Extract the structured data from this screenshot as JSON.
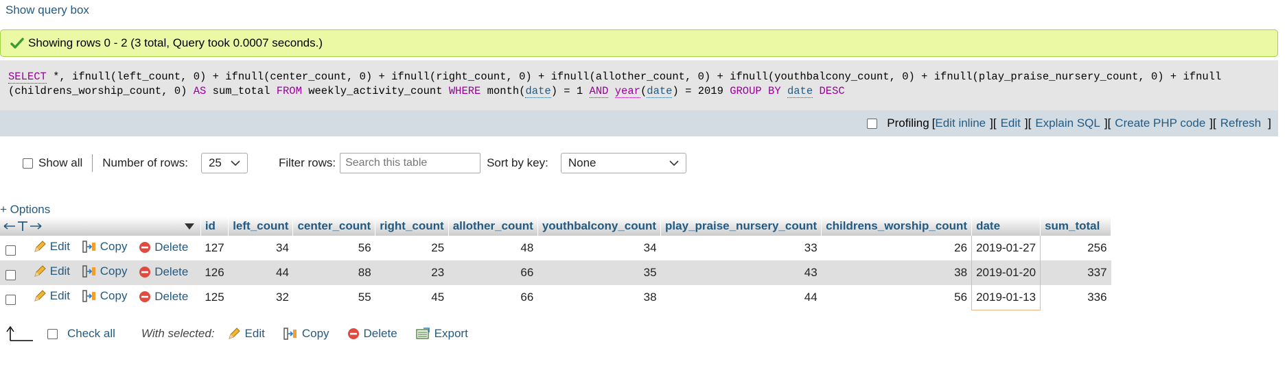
{
  "top": {
    "show_query_label": "Show query box"
  },
  "success": {
    "message": "Showing rows 0 - 2 (3 total, Query took 0.0007 seconds.)"
  },
  "sql": {
    "t1": "SELECT",
    "t2": " *, ifnull(left_count, 0) + ifnull(center_count, 0) + ifnull(right_count, 0) + ifnull(allother_count, 0) + ifnull(youthbalcony_count, 0) + ifnull(play_praise_nursery_count, 0) + ifnull (childrens_worship_count, 0) ",
    "t3": "AS",
    "t4": " sum_total ",
    "t5": "FROM",
    "t6": " weekly_activity_count ",
    "t7": "WHERE",
    "t8": " month(",
    "t9": "date",
    "t10": ") = 1 ",
    "t11": "AND",
    "t12": " ",
    "t13": "year",
    "t14": "(",
    "t15": "date",
    "t16": ") = 2019 ",
    "t17": "GROUP BY",
    "t18": " ",
    "t19": "date",
    "t20": " ",
    "t21": "DESC"
  },
  "profiling": {
    "label": "Profiling",
    "open_bracket": "[",
    "edit_inline": "Edit inline",
    "edit": "Edit",
    "explain": "Explain SQL",
    "php": "Create PHP code",
    "refresh": "Refresh",
    "sep": "][",
    "close_bracket": "]"
  },
  "nav": {
    "show_all": "Show all",
    "rows_label": "Number of rows:",
    "rows_value": "25",
    "filter_label": "Filter rows:",
    "filter_placeholder": "Search this table",
    "sort_label": "Sort by key:",
    "sort_value": "None"
  },
  "options_label": "+ Options",
  "table": {
    "columns": [
      "id",
      "left_count",
      "center_count",
      "right_count",
      "allother_count",
      "youthbalcony_count",
      "play_praise_nursery_count",
      "childrens_worship_count",
      "date",
      "sum_total"
    ],
    "action_edit": "Edit",
    "action_copy": "Copy",
    "action_delete": "Delete",
    "rows": [
      [
        "127",
        "34",
        "56",
        "25",
        "48",
        "34",
        "33",
        "26",
        "2019-01-27",
        "256"
      ],
      [
        "126",
        "44",
        "88",
        "23",
        "66",
        "35",
        "43",
        "38",
        "2019-01-20",
        "337"
      ],
      [
        "125",
        "32",
        "55",
        "45",
        "66",
        "38",
        "44",
        "56",
        "2019-01-13",
        "336"
      ]
    ]
  },
  "bottom": {
    "check_all": "Check all",
    "with_selected": "With selected:",
    "edit": "Edit",
    "copy": "Copy",
    "delete": "Delete",
    "export": "Export"
  }
}
